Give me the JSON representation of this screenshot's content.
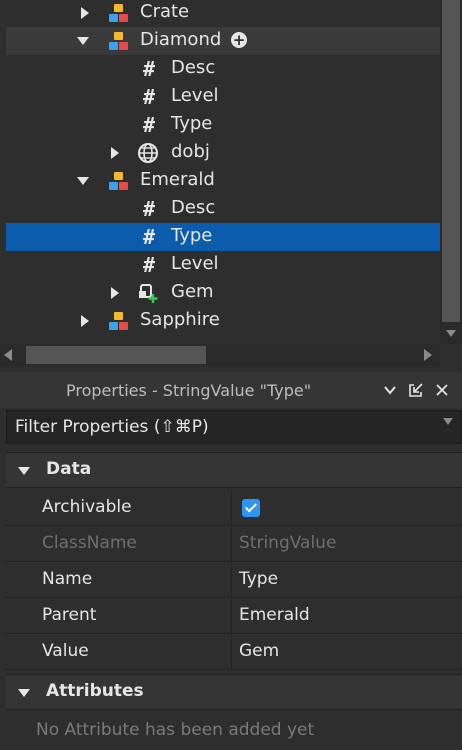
{
  "explorer": {
    "rows": [
      {
        "label": "Crate",
        "icon": "model-icon",
        "expand": "collapsed"
      },
      {
        "label": "Diamond",
        "icon": "model-icon",
        "expand": "expanded"
      },
      {
        "label": "Desc",
        "icon": "hash-icon"
      },
      {
        "label": "Level",
        "icon": "hash-icon"
      },
      {
        "label": "Type",
        "icon": "hash-icon"
      },
      {
        "label": "dobj",
        "icon": "globe-icon",
        "expand": "collapsed"
      },
      {
        "label": "Emerald",
        "icon": "model-icon",
        "expand": "expanded"
      },
      {
        "label": "Desc",
        "icon": "hash-icon"
      },
      {
        "label": "Type",
        "icon": "hash-icon"
      },
      {
        "label": "Level",
        "icon": "hash-icon"
      },
      {
        "label": "Gem",
        "icon": "part-plus-icon",
        "expand": "collapsed"
      },
      {
        "label": "Sapphire",
        "icon": "model-icon",
        "expand": "collapsed"
      }
    ],
    "hover_row": "Diamond",
    "selected_row": "Type"
  },
  "properties": {
    "title": "Properties - StringValue \"Type\"",
    "filter_placeholder": "Filter Properties (⇧⌘P)",
    "sections": {
      "data": "Data",
      "attributes": "Attributes"
    },
    "rows": {
      "archivable": {
        "name": "Archivable",
        "checked": true
      },
      "classname": {
        "name": "ClassName",
        "value": "StringValue"
      },
      "name": {
        "name": "Name",
        "value": "Type"
      },
      "parent": {
        "name": "Parent",
        "value": "Emerald"
      },
      "value": {
        "name": "Value",
        "value": "Gem"
      }
    },
    "no_attributes": "No Attribute has been added yet"
  },
  "colors": {
    "selection": "#0b5cad",
    "checkbox": "#2e95f0",
    "panel_bg": "#2e2e2e"
  }
}
